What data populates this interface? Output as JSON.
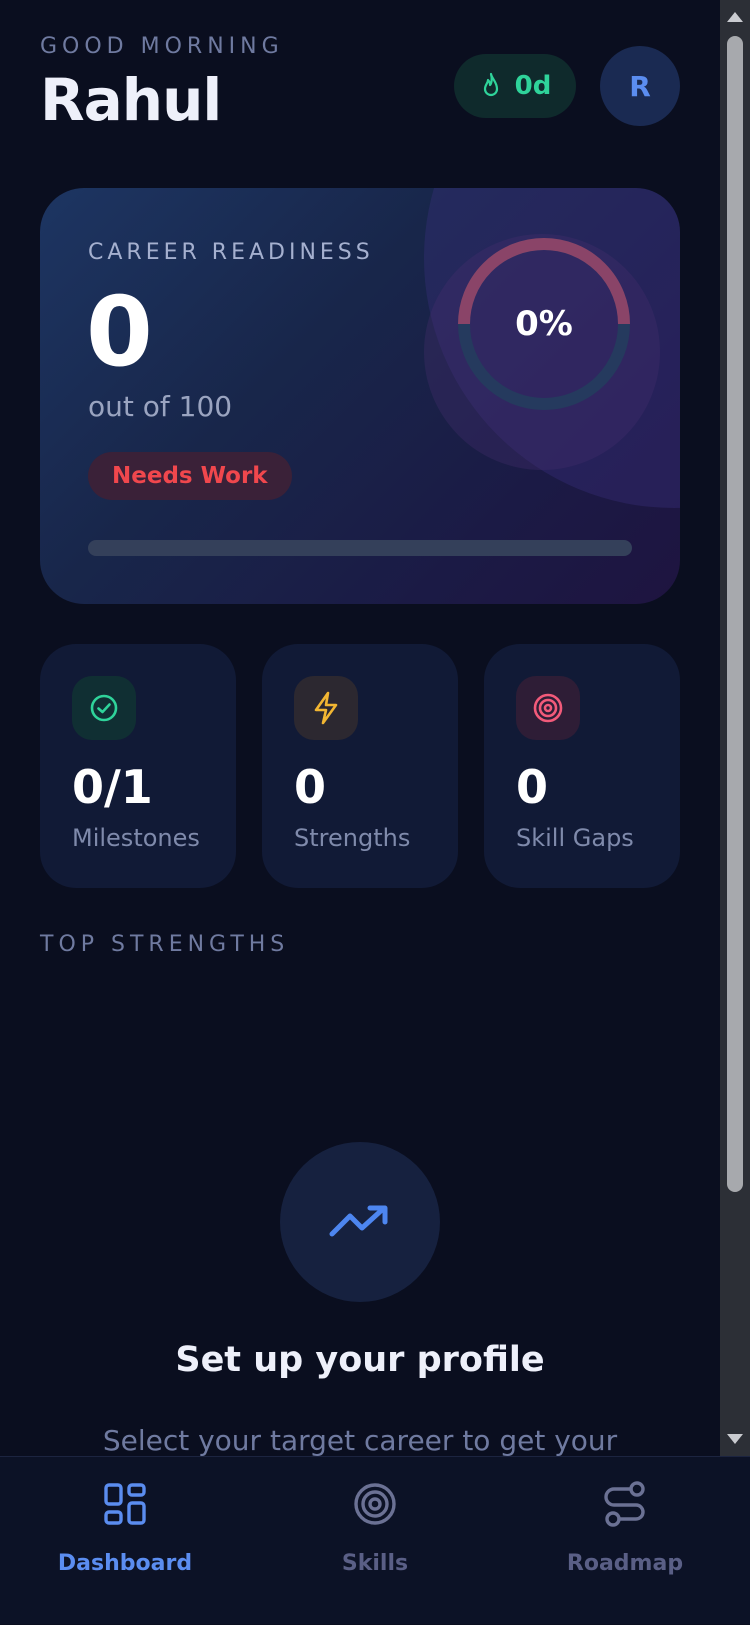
{
  "header": {
    "greeting": "GOOD MORNING",
    "username": "Rahul",
    "streak": "0d",
    "avatar_initial": "R"
  },
  "readiness": {
    "label": "CAREER READINESS",
    "score": "0",
    "out_of": "out of 100",
    "status": "Needs Work",
    "percent_text": "0%",
    "progress": 0
  },
  "stats": [
    {
      "value": "0/1",
      "label": "Milestones",
      "icon": "check-circle-icon",
      "color": "#2fd39a"
    },
    {
      "value": "0",
      "label": "Strengths",
      "icon": "lightning-icon",
      "color": "#f2b632"
    },
    {
      "value": "0",
      "label": "Skill Gaps",
      "icon": "target-icon",
      "color": "#f25a7a"
    }
  ],
  "top_strengths": {
    "title": "TOP STRENGTHS",
    "empty_title": "Set up your profile",
    "empty_desc": "Select your target career to get your"
  },
  "nav": {
    "items": [
      {
        "label": "Dashboard",
        "icon": "grid-icon",
        "active": true
      },
      {
        "label": "Skills",
        "icon": "target-icon",
        "active": false
      },
      {
        "label": "Roadmap",
        "icon": "route-icon",
        "active": false
      }
    ]
  },
  "colors": {
    "accent": "#5b8df0",
    "success": "#2fd39a",
    "warning": "#f2b632",
    "danger": "#f0474d",
    "background": "#0a0e1f"
  }
}
